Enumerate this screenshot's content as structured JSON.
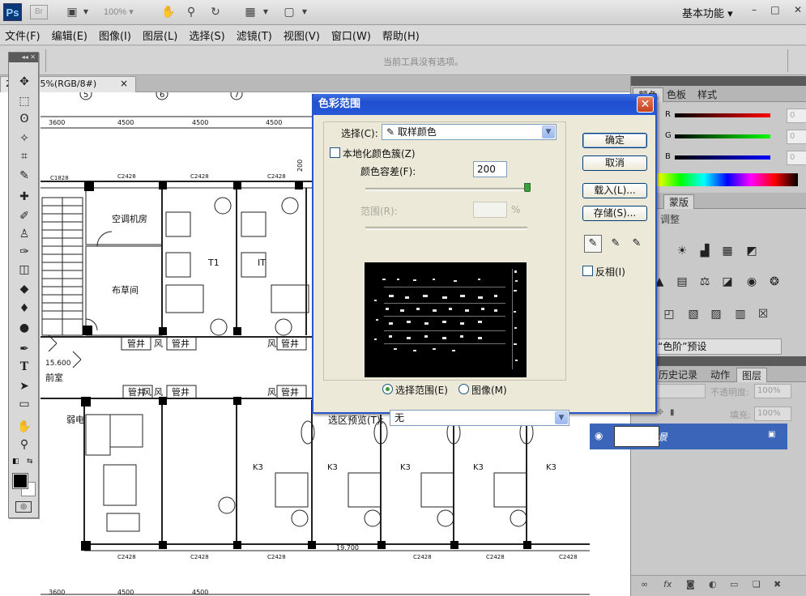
{
  "app": {
    "logo": "Ps",
    "bridge": "Br",
    "zoom": "100%",
    "workspace": "基本功能",
    "window_controls": [
      "–",
      "□",
      "✕"
    ]
  },
  "menu": [
    "文件(F)",
    "编辑(E)",
    "图像(I)",
    "图层(L)",
    "选择(S)",
    "滤镜(T)",
    "视图(V)",
    "窗口(W)",
    "帮助(H)"
  ],
  "options_bar": {
    "text": "当前工具没有选项。"
  },
  "document": {
    "tab_title": "2... @ 25%(RGB/8#)",
    "close": "×",
    "plan": {
      "grid_nums": [
        "5",
        "6",
        "7"
      ],
      "dims_top": [
        "3600",
        "4500",
        "4500",
        "4500"
      ],
      "dims_bottom": [
        "3600",
        "4500",
        "4500"
      ],
      "col_marks": [
        "C1828",
        "C2428",
        "C2428",
        "C2428"
      ],
      "bottom_marks": [
        "C2428",
        "C2428",
        "C2428",
        "C2428",
        "C2428",
        "C2428"
      ],
      "rooms": [
        "空调机房",
        "布草间",
        "前室",
        "弱电"
      ],
      "level": "15.600",
      "level_bottom": "19.700",
      "duct_labels": [
        "管井",
        "风",
        "管井",
        "风",
        "管井",
        "风",
        "管井",
        "风",
        "管井",
        "管井",
        "风"
      ],
      "unit_labels": [
        "T1",
        "IT",
        "K3",
        "K3",
        "K3",
        "K3",
        "K3"
      ],
      "vertical_mark": "200"
    }
  },
  "color_range_dialog": {
    "title": "色彩范围",
    "select_label": "选择(C):",
    "select_value": "取样颜色",
    "localized_label": "本地化颜色簇(Z)",
    "localized_checked": false,
    "fuzziness_label": "颜色容差(F):",
    "fuzziness_value": "200",
    "fuzziness_fraction": 1.0,
    "range_label": "范围(R):",
    "range_value": "",
    "range_unit": "%",
    "radio_selection": "选择范围(E)",
    "radio_image": "图像(M)",
    "radio_selected": "selection",
    "preview_label": "选区预览(T):",
    "preview_value": "无",
    "buttons": {
      "ok": "确定",
      "cancel": "取消",
      "load": "载入(L)...",
      "save": "存储(S)..."
    },
    "invert_label": "反相(I)",
    "invert_checked": false
  },
  "panels": {
    "color_tabs": [
      "颜色",
      "色板",
      "样式"
    ],
    "rgb": {
      "r_label": "R",
      "g_label": "G",
      "b_label": "B",
      "r": "0",
      "g": "0",
      "b": "0"
    },
    "adjust_tabs": [
      "调整",
      "蒙版"
    ],
    "adjust_heading": "调整",
    "preset": "“色阶”预设",
    "layers_tabs": [
      "历史记录",
      "动作",
      "图层"
    ],
    "opacity_label": "不透明度:",
    "opacity_value": "100%",
    "fill_label": "填充:",
    "fill_value": "100%",
    "layer_name": "背景"
  }
}
